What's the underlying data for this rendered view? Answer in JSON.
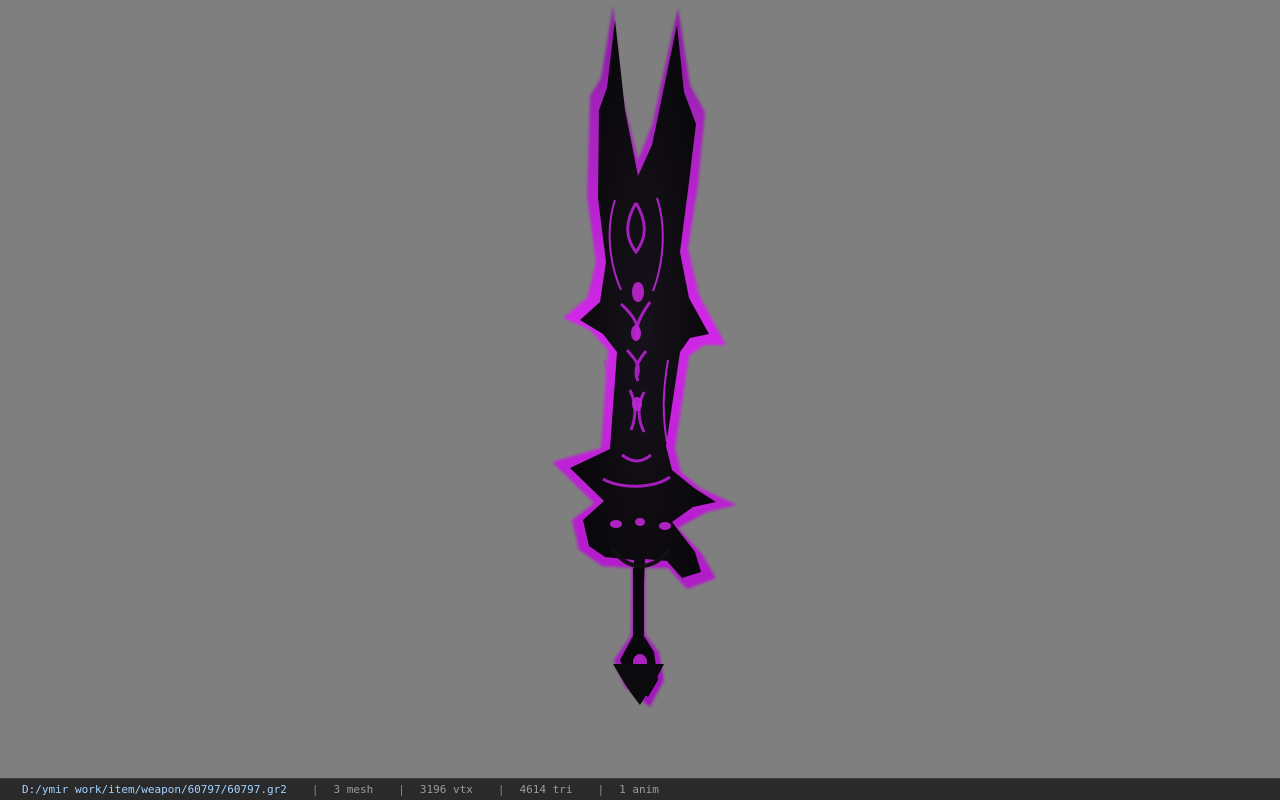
{
  "viewer": {
    "background_color": "#7f7f7f",
    "model_primary_color": "#0b0a0d",
    "model_glow_color": "#c21fd6",
    "model_name": "60797.gr2"
  },
  "status_bar": {
    "path": "D:/ymir work/item/weapon/60797/60797.gr2",
    "separator": "|",
    "mesh": "3 mesh",
    "vtx": "3196 vtx",
    "tri": "4614 tri",
    "anim": "1 anim"
  },
  "icons": {
    "model": "sword-model-icon"
  }
}
